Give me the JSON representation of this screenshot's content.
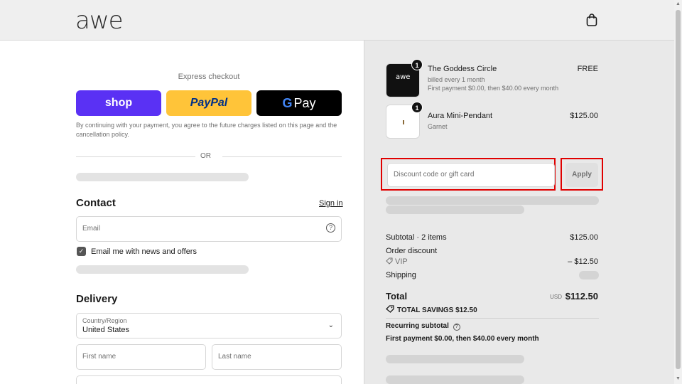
{
  "header": {
    "logo": "awe",
    "bag_icon": "shopping-bag-icon"
  },
  "express": {
    "title": "Express checkout",
    "shop_label": "shop",
    "paypal_label": "PayPal",
    "gpay_g": "G",
    "gpay_label": "Pay",
    "consent": "By continuing with your payment, you agree to the future charges listed on this page and the cancellation policy.",
    "or_label": "OR"
  },
  "contact": {
    "title": "Contact",
    "signin": "Sign in",
    "email_placeholder": "Email",
    "help_glyph": "?",
    "news_label": "Email me with news and offers",
    "check_glyph": "✓"
  },
  "delivery": {
    "title": "Delivery",
    "country_label": "Country/Region",
    "country_value": "United States",
    "chevron_glyph": "⌄",
    "first_name": "First name",
    "last_name": "Last name"
  },
  "order": {
    "items": [
      {
        "thumb_text": "awe",
        "qty": "1",
        "name": "The Goddess Circle",
        "sub1": "billed every 1 month",
        "sub2": "First payment $0.00, then $40.00 every month",
        "price": "FREE"
      },
      {
        "qty": "1",
        "name": "Aura Mini-Pendant",
        "sub1": "Garnet",
        "price": "$125.00"
      }
    ],
    "discount_placeholder": "Discount code or gift card",
    "apply_label": "Apply",
    "subtotal_label": "Subtotal · 2 items",
    "subtotal_value": "$125.00",
    "order_discount_label": "Order discount",
    "vip_label": "VIP",
    "vip_value": "– $12.50",
    "shipping_label": "Shipping",
    "total_label": "Total",
    "currency": "USD",
    "total_value": "$112.50",
    "savings_label": "TOTAL SAVINGS",
    "savings_value": "$12.50",
    "recurring_title": "Recurring subtotal",
    "recurring_line": "First payment $0.00, then $40.00 every month"
  },
  "colors": {
    "shop": "#5a31f4",
    "paypal": "#ffc439",
    "highlight": "#e00000"
  }
}
